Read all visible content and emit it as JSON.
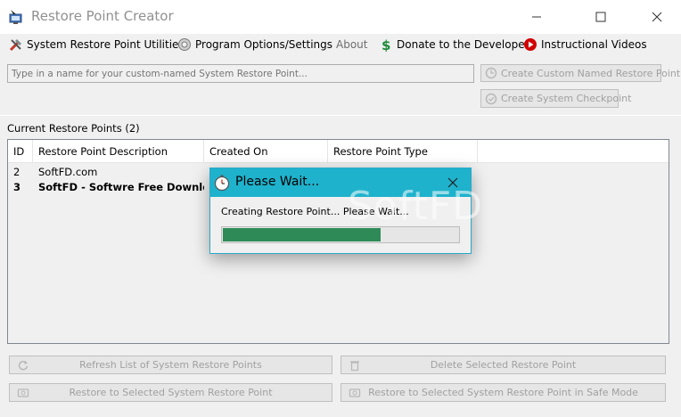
{
  "window": {
    "title": "Restore Point Creator",
    "controls": {
      "minimize": "—",
      "maximize": "☐",
      "close": "✕"
    }
  },
  "menu": [
    {
      "label": "System Restore Point Utilities",
      "icon": "tools-icon"
    },
    {
      "label": "Program Options/Settings",
      "icon": "gear-icon"
    },
    {
      "label": "About",
      "icon": ""
    },
    {
      "label": "Donate to the Developer",
      "icon": "dollar-icon"
    },
    {
      "label": "Instructional Videos",
      "icon": "play-icon"
    }
  ],
  "create": {
    "placeholder": "Type in a name for your custom-named System Restore Point...",
    "value": "",
    "custom_button": "Create Custom Named Restore Point",
    "checkpoint_button": "Create System Checkpoint"
  },
  "restore_points": {
    "section_label": "Current Restore Points (2)",
    "columns": [
      "ID",
      "Restore Point Description",
      "Created On",
      "Restore Point Type"
    ],
    "rows": [
      {
        "id": "2",
        "description": "SoftFD.com",
        "created_on": "",
        "type": "",
        "bold": false
      },
      {
        "id": "3",
        "description": "SoftFD - Softwre Free Download",
        "created_on": "",
        "type": "",
        "bold": true
      }
    ]
  },
  "actions": {
    "refresh": "Refresh List of System Restore Points",
    "delete": "Delete Selected Restore Point",
    "restore": "Restore to Selected System Restore Point",
    "restore_safe": "Restore to Selected System Restore Point in Safe Mode"
  },
  "dialog": {
    "title": "Please Wait...",
    "message": "Creating Restore Point... Please Wait...",
    "progress": 0.67,
    "close": "✕"
  },
  "watermark": "SoftFD",
  "colors": {
    "dialog_title_bg": "#1fb2cc",
    "progress_fill": "#2e8b57",
    "disabled_text": "#a0a0a0"
  }
}
